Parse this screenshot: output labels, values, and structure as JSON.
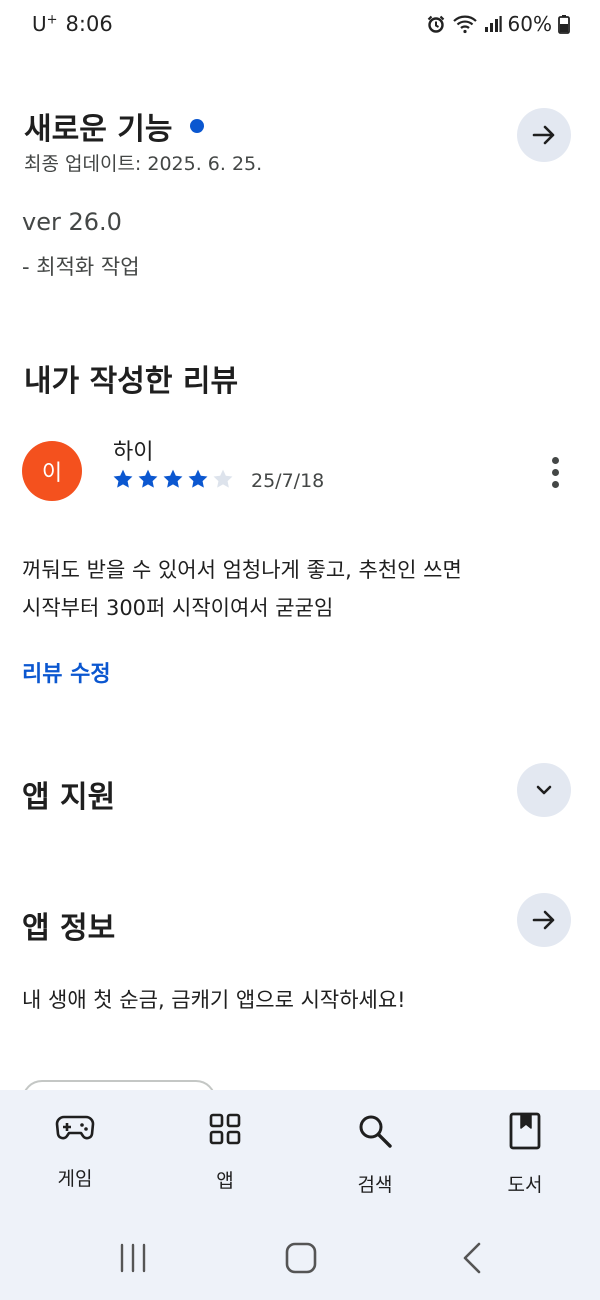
{
  "status_bar": {
    "carrier": "U",
    "carrier_sup": "+",
    "time": "8:06",
    "battery": "60%",
    "icons": [
      "alarm-icon",
      "wifi-icon",
      "signal-icon",
      "battery-icon"
    ]
  },
  "whats_new": {
    "title": "새로운 기능",
    "last_updated": "최종 업데이트: 2025. 6. 25.",
    "version": "ver 26.0",
    "note": "- 최적화 작업"
  },
  "my_review": {
    "title": "내가 작성한 리뷰",
    "avatar_letter": "이",
    "reviewer": "하이",
    "rating": 4,
    "rating_max": 5,
    "date": "25/7/18",
    "text_line1": "꺼둬도 받을 수 있어서 엄청나게 좋고, 추천인 쓰면",
    "text_line2": "시작부터 300퍼 시작이여서 굳굳임",
    "edit_label": "리뷰 수정"
  },
  "app_support": {
    "title": "앱 지원"
  },
  "app_info": {
    "title": "앱 정보",
    "description": "내 생애 첫 순금, 금캐기 앱으로 시작하세요!"
  },
  "bottom_nav": {
    "items": [
      {
        "label": "게임",
        "icon": "gamepad-icon"
      },
      {
        "label": "앱",
        "icon": "apps-grid-icon"
      },
      {
        "label": "검색",
        "icon": "search-icon"
      },
      {
        "label": "도서",
        "icon": "book-icon"
      }
    ]
  },
  "colors": {
    "accent": "#0b57d0",
    "avatar": "#f4511e",
    "round_button_bg": "#e3e8f1",
    "nav_bg": "#eef2f9"
  }
}
